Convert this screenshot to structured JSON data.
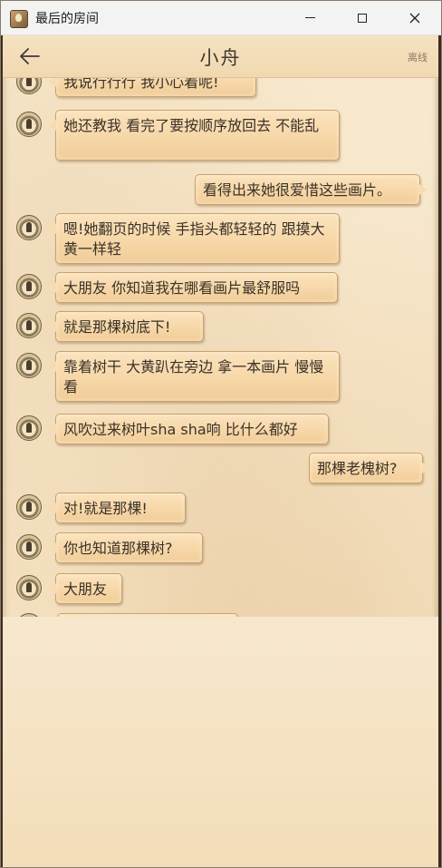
{
  "window": {
    "title": "最后的房间"
  },
  "header": {
    "contact_name": "小舟",
    "status": "离线"
  },
  "messages": [
    {
      "side": "left",
      "text": "我说行行行 我小心着呢!"
    },
    {
      "side": "left",
      "text": "她还教我 看完了要按顺序放回去 不能乱"
    },
    {
      "side": "right",
      "text": "看得出来她很爱惜这些画片。"
    },
    {
      "side": "left",
      "text": "嗯!她翻页的时候 手指头都轻轻的 跟摸大黄一样轻"
    },
    {
      "side": "left",
      "text": "大朋友 你知道我在哪看画片最舒服吗"
    },
    {
      "side": "left",
      "text": "就是那棵树底下!"
    },
    {
      "side": "left",
      "text": "靠着树干 大黄趴在旁边 拿一本画片 慢慢看"
    },
    {
      "side": "left",
      "text": "风吹过来树叶sha sha响 比什么都好"
    },
    {
      "side": "right",
      "text": "那棵老槐树?"
    },
    {
      "side": "left",
      "text": "对!就是那棵!"
    },
    {
      "side": "left",
      "text": "你也知道那棵树?"
    },
    {
      "side": "left",
      "text": "大朋友"
    }
  ]
}
